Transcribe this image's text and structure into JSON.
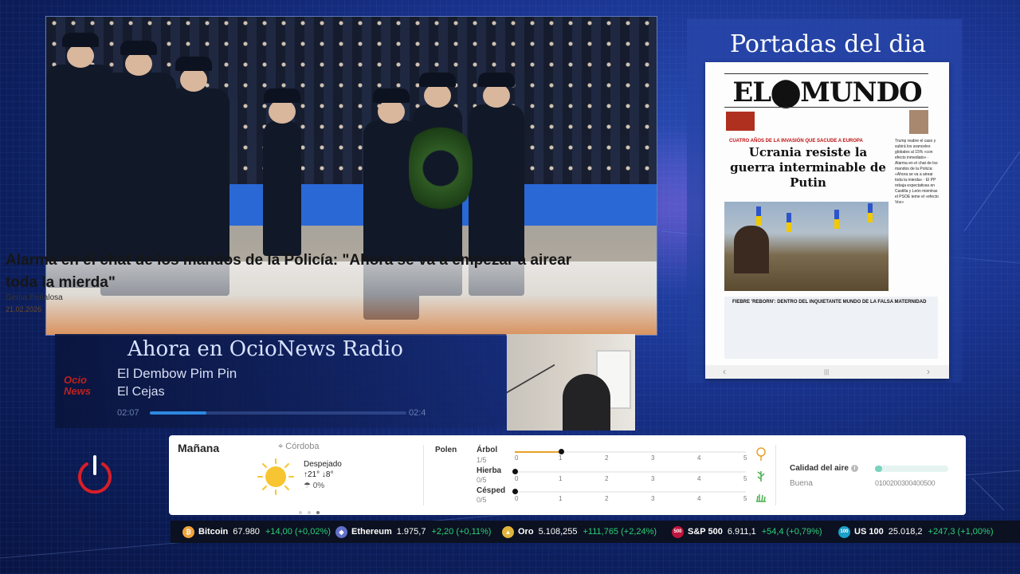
{
  "news": {
    "title": "Alarma en el chat de los mandos de la Policía: \"Ahora se va a empezar a airear toda la mierda\"",
    "author": "Gema Peñalosa",
    "date": "21.02.2026"
  },
  "portadas": {
    "title": "Portadas del dia",
    "newspaper_logo": "EL⬤MUNDO",
    "kicker": "CUATRO AÑOS DE LA INVASIÓN QUE SACUDE A EUROPA",
    "headline": "Ucrania resiste la guerra interminable de Putin",
    "side_text": "Trump reabre el caso y subirá los aranceles globales al 15% «con efecto inmediato» · Alarma en el chat de los mandos de la Policía: «Ahora se va a airear toda la mierda» · El PP rebaja expectativas en Castilla y León mientras el PSOE teme el «efecto Vox»",
    "bottom_text": "FIEBRE 'REBORN': DENTRO DEL INQUIETANTE MUNDO DE LA FALSA MATERNIDAD",
    "nav_prev": "‹",
    "nav_mid": "|||",
    "nav_next": "›"
  },
  "radio": {
    "heading": "Ahora en OcioNews Radio",
    "song": "El Dembow Pim Pin",
    "artist": "El Cejas",
    "logo": "Ocio News",
    "time_elapsed": "02:07",
    "time_total": "02:4",
    "progress": 0.22
  },
  "weather": {
    "day": "Mañana",
    "location": "Córdoba",
    "description": "Despejado",
    "temp_max": "21°",
    "temp_min": "8°",
    "rain": "0%",
    "polen_label": "Polen",
    "polen": [
      {
        "name": "Árbol",
        "value": "1/5",
        "level": 1
      },
      {
        "name": "Hierba",
        "value": "0/5",
        "level": 0
      },
      {
        "name": "Césped",
        "value": "0/5",
        "level": 0
      }
    ],
    "scale": [
      "0",
      "1",
      "2",
      "3",
      "4",
      "5"
    ],
    "air_label": "Calidad del aire",
    "air_value": "Buena",
    "air_level": 0.1,
    "air_scale": "0100200300400500"
  },
  "ticker": [
    {
      "icon": "bitcoin-icon",
      "icon_text": "₿",
      "color": "#f2a33a",
      "name": "Bitcoin",
      "price": "67.980",
      "change": "+14,00 (+0,02%)"
    },
    {
      "icon": "ethereum-icon",
      "icon_text": "◆",
      "color": "#6270c8",
      "name": "Ethereum",
      "price": "1.975,7",
      "change": "+2,20 (+0,11%)"
    },
    {
      "icon": "gold-icon",
      "icon_text": "▲",
      "color": "#e1b53a",
      "name": "Oro",
      "price": "5.108,255",
      "change": "+111,765 (+2,24%)"
    },
    {
      "icon": "sp500-icon",
      "icon_text": "500",
      "color": "#c0143c",
      "name": "S&P 500",
      "price": "6.911,1",
      "change": "+54,4 (+0,79%)"
    },
    {
      "icon": "us100-icon",
      "icon_text": "100",
      "color": "#1aa0c9",
      "name": "US 100",
      "price": "25.018,2",
      "change": "+247,3 (+1,00%)"
    }
  ]
}
